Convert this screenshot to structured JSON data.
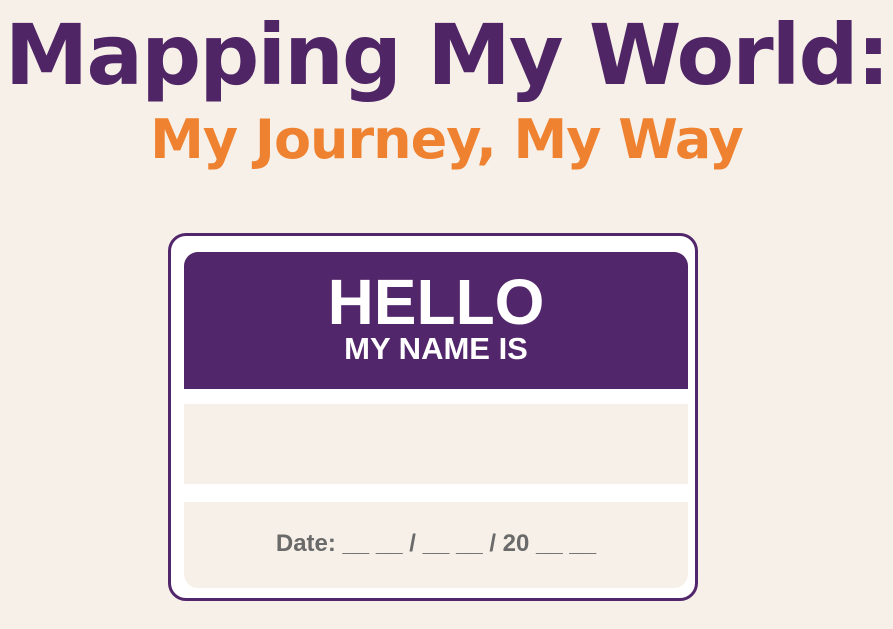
{
  "header": {
    "title": "Mapping My World:",
    "subtitle": "My Journey, My Way"
  },
  "name_tag": {
    "greeting": "HELLO",
    "intro": "MY NAME IS",
    "name_value": "",
    "date_line": "Date: __ __ / __ __ / 20 __ __"
  },
  "colors": {
    "purple": "#52266a",
    "orange": "#ef8230",
    "background": "#f6f0e8",
    "date_gray": "#6a6a6a"
  }
}
